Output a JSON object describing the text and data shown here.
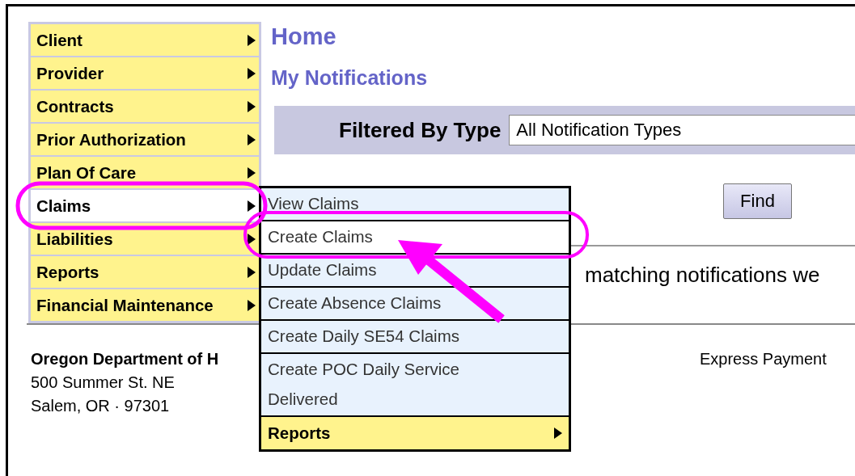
{
  "sidebar": {
    "items": [
      {
        "label": "Client",
        "selected": false
      },
      {
        "label": "Provider",
        "selected": false
      },
      {
        "label": "Contracts",
        "selected": false
      },
      {
        "label": "Prior Authorization",
        "selected": false
      },
      {
        "label": "Plan Of Care",
        "selected": false
      },
      {
        "label": "Claims",
        "selected": true
      },
      {
        "label": "Liabilities",
        "selected": false
      },
      {
        "label": "Reports",
        "selected": false
      },
      {
        "label": "Financial Maintenance",
        "selected": false
      }
    ]
  },
  "page": {
    "title": "Home",
    "subtitle": "My Notifications"
  },
  "filter": {
    "label": "Filtered By Type",
    "value": "All Notification Types"
  },
  "find_button": "Find",
  "message": "matching notifications we",
  "submenu": {
    "items": [
      {
        "kind": "link",
        "lines": [
          "View Claims"
        ],
        "selected": false
      },
      {
        "kind": "link",
        "lines": [
          "Create Claims"
        ],
        "selected": true
      },
      {
        "kind": "link",
        "lines": [
          "Update Claims"
        ],
        "selected": false
      },
      {
        "kind": "link",
        "lines": [
          "Create Absence Claims"
        ],
        "selected": false
      },
      {
        "kind": "link",
        "lines": [
          "Create Daily SE54 Claims"
        ],
        "selected": false
      },
      {
        "kind": "link",
        "lines": [
          "Create POC Daily Service",
          "Delivered"
        ],
        "selected": false
      },
      {
        "kind": "submenu",
        "lines": [
          "Reports"
        ],
        "selected": false
      }
    ]
  },
  "footer": {
    "org": "Oregon Department of H",
    "address": [
      "500 Summer St. NE",
      "Salem, OR · 97301"
    ],
    "right": "Express Payment"
  }
}
